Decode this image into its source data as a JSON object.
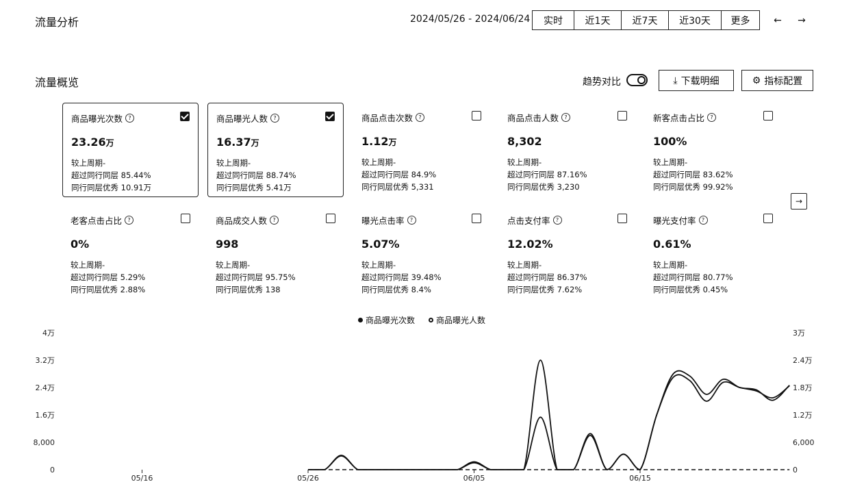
{
  "header": {
    "title": "流量分析",
    "date_range": "2024/05/26 - 2024/06/24",
    "tabs": [
      "实时",
      "近1天",
      "近7天",
      "近30天",
      "更多"
    ],
    "prev_icon": "←",
    "next_icon": "→"
  },
  "overview": {
    "title": "流量概览",
    "trend_compare_label": "趋势对比",
    "download_label": "下载明细",
    "config_label": "指标配置",
    "next_icon": "→"
  },
  "metrics": [
    {
      "label": "商品曝光次数",
      "value": "23.26",
      "unit": "万",
      "checked": true,
      "period": "较上周期-",
      "peer": "超过同行同层 85.44%",
      "excellent": "同行同层优秀 10.91万"
    },
    {
      "label": "商品曝光人数",
      "value": "16.37",
      "unit": "万",
      "checked": true,
      "period": "较上周期-",
      "peer": "超过同行同层 88.74%",
      "excellent": "同行同层优秀 5.41万"
    },
    {
      "label": "商品点击次数",
      "value": "1.12",
      "unit": "万",
      "checked": false,
      "period": "较上周期-",
      "peer": "超过同行同层 84.9%",
      "excellent": "同行同层优秀 5,331"
    },
    {
      "label": "商品点击人数",
      "value": "8,302",
      "unit": "",
      "checked": false,
      "period": "较上周期-",
      "peer": "超过同行同层 87.16%",
      "excellent": "同行同层优秀 3,230"
    },
    {
      "label": "新客点击占比",
      "value": "100%",
      "unit": "",
      "checked": false,
      "period": "较上周期-",
      "peer": "超过同行同层 83.62%",
      "excellent": "同行同层优秀 99.92%"
    },
    {
      "label": "老客点击占比",
      "value": "0%",
      "unit": "",
      "checked": false,
      "period": "较上周期-",
      "peer": "超过同行同层 5.29%",
      "excellent": "同行同层优秀 2.88%"
    },
    {
      "label": "商品成交人数",
      "value": "998",
      "unit": "",
      "checked": false,
      "period": "较上周期-",
      "peer": "超过同行同层 95.75%",
      "excellent": "同行同层优秀 138"
    },
    {
      "label": "曝光点击率",
      "value": "5.07%",
      "unit": "",
      "checked": false,
      "period": "较上周期-",
      "peer": "超过同行同层 39.48%",
      "excellent": "同行同层优秀 8.4%"
    },
    {
      "label": "点击支付率",
      "value": "12.02%",
      "unit": "",
      "checked": false,
      "period": "较上周期-",
      "peer": "超过同行同层 86.37%",
      "excellent": "同行同层优秀 7.62%"
    },
    {
      "label": "曝光支付率",
      "value": "0.61%",
      "unit": "",
      "checked": false,
      "period": "较上周期-",
      "peer": "超过同行同层 80.77%",
      "excellent": "同行同层优秀 0.45%"
    }
  ],
  "chart_data": {
    "type": "line",
    "x_ticks": [
      "05/16",
      "05/26",
      "06/05",
      "06/15"
    ],
    "x": [
      "05/26",
      "05/27",
      "05/28",
      "05/29",
      "05/30",
      "05/31",
      "06/01",
      "06/02",
      "06/03",
      "06/04",
      "06/05",
      "06/06",
      "06/07",
      "06/08",
      "06/09",
      "06/10",
      "06/11",
      "06/12",
      "06/13",
      "06/14",
      "06/15",
      "06/16",
      "06/17",
      "06/18",
      "06/19",
      "06/20",
      "06/21",
      "06/22",
      "06/23",
      "06/24"
    ],
    "y_left_ticks": [
      "0",
      "8,000",
      "1.6万",
      "2.4万",
      "3.2万",
      "4万"
    ],
    "y_right_ticks": [
      "0",
      "6,000",
      "1.2万",
      "1.8万",
      "2.4万",
      "3万"
    ],
    "ylim_left": [
      0,
      40000
    ],
    "ylim_right": [
      0,
      30000
    ],
    "series": [
      {
        "name": "商品曝光次数",
        "axis": "left",
        "values": [
          0,
          0,
          4200,
          0,
          0,
          0,
          0,
          0,
          0,
          0,
          2300,
          0,
          0,
          0,
          32000,
          0,
          0,
          10000,
          0,
          4500,
          0,
          16000,
          27000,
          26000,
          20000,
          25500,
          24000,
          23000,
          21000,
          24500
        ]
      },
      {
        "name": "商品曝光人数",
        "axis": "right",
        "values": [
          0,
          0,
          3000,
          0,
          0,
          0,
          0,
          0,
          0,
          0,
          1500,
          0,
          0,
          0,
          11500,
          0,
          0,
          7900,
          0,
          3400,
          0,
          12000,
          21000,
          20500,
          16500,
          19800,
          18000,
          17500,
          15200,
          18500
        ]
      },
      {
        "name": "",
        "axis": "left",
        "values": [
          0,
          0,
          0,
          0,
          0,
          0,
          0,
          0,
          0,
          0,
          0,
          0,
          0,
          0,
          0,
          0,
          0,
          0,
          0,
          0,
          0,
          0,
          0,
          0,
          0,
          0,
          0,
          0,
          0,
          0
        ]
      }
    ]
  }
}
